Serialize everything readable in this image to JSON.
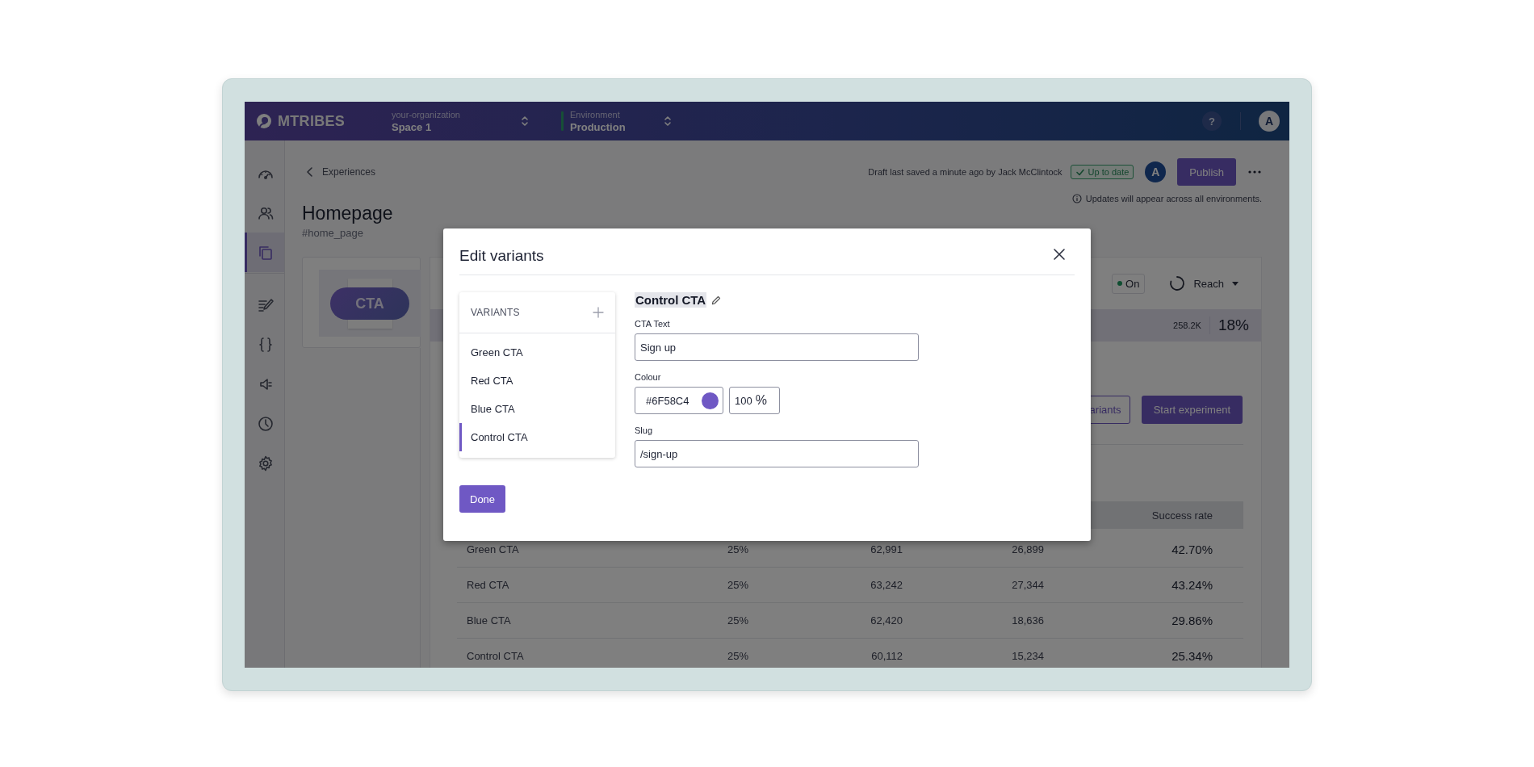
{
  "topbar": {
    "logo": "MTRIBES",
    "organization": {
      "label": "your-organization",
      "value": "Space 1"
    },
    "environment": {
      "label": "Environment",
      "value": "Production"
    },
    "help": "?",
    "avatar": "A"
  },
  "sidebar": {
    "items": [
      {
        "kind": "gauge",
        "selected": false
      },
      {
        "kind": "people",
        "selected": false
      },
      {
        "kind": "copy",
        "selected": true
      },
      {
        "kind": "divider"
      },
      {
        "kind": "edit",
        "selected": false
      },
      {
        "kind": "braces",
        "selected": false
      },
      {
        "kind": "speaker",
        "selected": false
      },
      {
        "kind": "clock",
        "selected": false
      },
      {
        "kind": "gear",
        "selected": false
      }
    ]
  },
  "header": {
    "back": "Experiences",
    "title": "Homepage",
    "tag": "#home_page",
    "saved_note": "Draft last saved a minute ago by Jack McClintock",
    "status": "Up to date",
    "avatar": "A",
    "publish": "Publish",
    "info": "Updates will appear across all environments."
  },
  "preview": {
    "label": "CTA"
  },
  "panel": {
    "state": "On",
    "reach": "Reach",
    "audience": "258.2K",
    "share": "18%",
    "buttons": [
      {
        "label": "ariants",
        "kind": "outline"
      },
      {
        "label": "Start experiment",
        "kind": "primary"
      }
    ],
    "table": {
      "last_column": "Success rate",
      "rows": [
        {
          "cells": [
            "Green CTA",
            "25%",
            "62,991",
            "26,899",
            "42.70%"
          ]
        },
        {
          "cells": [
            "Red CTA",
            "25%",
            "63,242",
            "27,344",
            "43.24%"
          ]
        },
        {
          "cells": [
            "Blue CTA",
            "25%",
            "62,420",
            "18,636",
            "29.86%"
          ]
        },
        {
          "cells": [
            "Control CTA",
            "25%",
            "60,112",
            "15,234",
            "25.34%"
          ]
        }
      ]
    }
  },
  "modal": {
    "title": "Edit variants",
    "list_heading": "VARIANTS",
    "variants": [
      {
        "name": "Green CTA",
        "selected": false
      },
      {
        "name": "Red CTA",
        "selected": false
      },
      {
        "name": "Blue CTA",
        "selected": false
      },
      {
        "name": "Control CTA",
        "selected": true
      }
    ],
    "variant_name": "Control CTA",
    "fields": [
      {
        "kind": "text",
        "label": "CTA Text",
        "value": "Sign up"
      },
      {
        "kind": "colour",
        "label": "Colour",
        "value": "#6F58C4",
        "opacity": "100",
        "unit": "%"
      },
      {
        "kind": "text",
        "label": "Slug",
        "value": "/sign-up"
      }
    ],
    "done": "Done"
  }
}
